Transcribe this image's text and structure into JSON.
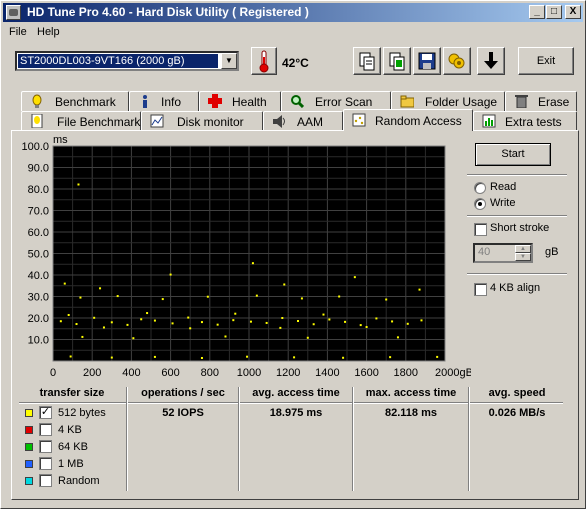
{
  "window": {
    "title": "HD Tune Pro 4.60 - Hard Disk Utility (  Registered )",
    "min_glyph": "_",
    "max_glyph": "□",
    "close_glyph": "X"
  },
  "menu": {
    "file": "File",
    "help": "Help"
  },
  "toolbar": {
    "drive": "ST2000DL003-9VT166 (2000 gB)",
    "temperature": "42°C",
    "exit_label": "Exit"
  },
  "tabs_top": [
    {
      "label": "Benchmark",
      "icon": "benchmark-icon"
    },
    {
      "label": "Info",
      "icon": "info-icon"
    },
    {
      "label": "Health",
      "icon": "health-icon"
    },
    {
      "label": "Error Scan",
      "icon": "magnifier-icon"
    },
    {
      "label": "Folder Usage",
      "icon": "folder-icon"
    },
    {
      "label": "Erase",
      "icon": "trash-icon"
    }
  ],
  "tabs_bottom": [
    {
      "label": "File Benchmark",
      "icon": "file-benchmark-icon"
    },
    {
      "label": "Disk monitor",
      "icon": "disk-monitor-icon"
    },
    {
      "label": "AAM",
      "icon": "speaker-icon"
    },
    {
      "label": "Random Access",
      "icon": "random-access-icon",
      "active": true
    },
    {
      "label": "Extra tests",
      "icon": "extra-tests-icon"
    }
  ],
  "controls": {
    "start_label": "Start",
    "read_label": "Read",
    "write_label": "Write",
    "mode_selected": "Write",
    "short_stroke_label": "Short stroke",
    "short_stroke_value": "40",
    "short_stroke_unit": "gB",
    "align_label": "4 KB align"
  },
  "chart_data": {
    "type": "scatter",
    "title": "",
    "ylabel": "ms",
    "xlabel": "",
    "xlim": [
      0,
      2000
    ],
    "ylim": [
      0,
      100
    ],
    "x_ticks": [
      "0",
      "200",
      "400",
      "600",
      "800",
      "1000",
      "1200",
      "1400",
      "1600",
      "1800",
      "2000gB"
    ],
    "y_ticks": [
      "10.0",
      "20.0",
      "30.0",
      "40.0",
      "50.0",
      "60.0",
      "70.0",
      "80.0",
      "90.0",
      "100.0"
    ],
    "grid": true,
    "background": "#000000",
    "series": [
      {
        "color": "#ffff00",
        "points": [
          [
            40,
            18.5
          ],
          [
            120,
            17.2
          ],
          [
            210,
            20.1
          ],
          [
            300,
            18.0
          ],
          [
            380,
            16.8
          ],
          [
            450,
            19.4
          ],
          [
            520,
            18.8
          ],
          [
            610,
            17.5
          ],
          [
            690,
            20.2
          ],
          [
            760,
            18.1
          ],
          [
            840,
            16.9
          ],
          [
            920,
            19.0
          ],
          [
            1010,
            18.3
          ],
          [
            1090,
            17.7
          ],
          [
            1170,
            20.0
          ],
          [
            1250,
            18.6
          ],
          [
            1330,
            17.1
          ],
          [
            1410,
            19.3
          ],
          [
            1490,
            18.2
          ],
          [
            1570,
            16.7
          ],
          [
            1650,
            19.8
          ],
          [
            1730,
            18.4
          ],
          [
            1810,
            17.3
          ],
          [
            1880,
            18.9
          ],
          [
            80,
            21.4
          ],
          [
            260,
            15.6
          ],
          [
            480,
            22.3
          ],
          [
            700,
            15.2
          ],
          [
            930,
            22.0
          ],
          [
            1160,
            15.4
          ],
          [
            1380,
            21.6
          ],
          [
            1600,
            15.8
          ],
          [
            140,
            29.5
          ],
          [
            330,
            30.2
          ],
          [
            560,
            28.8
          ],
          [
            790,
            29.9
          ],
          [
            1040,
            30.4
          ],
          [
            1270,
            29.1
          ],
          [
            1460,
            30.0
          ],
          [
            1700,
            28.6
          ],
          [
            60,
            36.0
          ],
          [
            240,
            33.8
          ],
          [
            600,
            40.2
          ],
          [
            1020,
            45.5
          ],
          [
            1180,
            35.6
          ],
          [
            1540,
            39.0
          ],
          [
            1870,
            33.2
          ],
          [
            90,
            2.1
          ],
          [
            300,
            1.6
          ],
          [
            520,
            1.9
          ],
          [
            760,
            1.4
          ],
          [
            990,
            2.0
          ],
          [
            1230,
            1.7
          ],
          [
            1480,
            1.5
          ],
          [
            1720,
            1.8
          ],
          [
            1960,
            1.9
          ],
          [
            130,
            82.1
          ],
          [
            150,
            11.2
          ],
          [
            410,
            10.6
          ],
          [
            880,
            11.4
          ],
          [
            1300,
            10.8
          ],
          [
            1760,
            11.0
          ]
        ]
      }
    ]
  },
  "results": {
    "headers": [
      "transfer size",
      "operations / sec",
      "avg. access time",
      "max. access time",
      "avg. speed"
    ],
    "rows": [
      {
        "label": "512 bytes",
        "color": "#ffff00",
        "checked": true,
        "ops": "52 IOPS",
        "avg": "18.975 ms",
        "max": "82.118 ms",
        "speed": "0.026 MB/s"
      },
      {
        "label": "4 KB",
        "color": "#e00000",
        "checked": false
      },
      {
        "label": "64 KB",
        "color": "#00c000",
        "checked": false
      },
      {
        "label": "1 MB",
        "color": "#2060ff",
        "checked": false
      },
      {
        "label": "Random",
        "color": "#00d8e0",
        "checked": false
      }
    ]
  }
}
